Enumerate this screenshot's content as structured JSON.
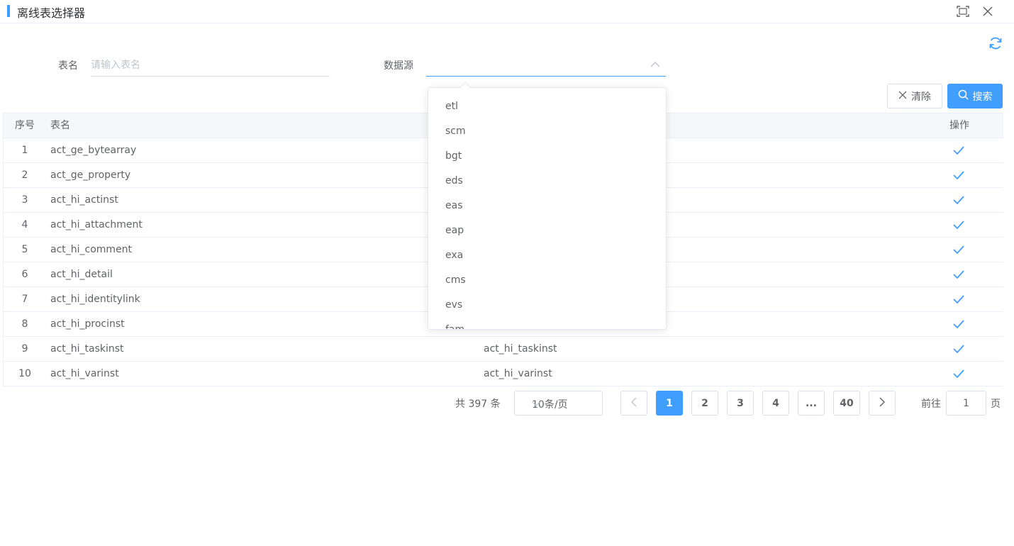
{
  "header": {
    "title": "离线表选择器"
  },
  "filters": {
    "table_name_label": "表名",
    "table_name_placeholder": "请输入表名",
    "table_name_value": "",
    "datasource_label": "数据源",
    "datasource_value": ""
  },
  "buttons": {
    "clear": "清除",
    "search": "搜索"
  },
  "table": {
    "columns": {
      "index": "序号",
      "name": "表名",
      "operation": "操作"
    },
    "rows": [
      {
        "index": "1",
        "name": "act_ge_bytearray",
        "comment": ""
      },
      {
        "index": "2",
        "name": "act_ge_property",
        "comment": ""
      },
      {
        "index": "3",
        "name": "act_hi_actinst",
        "comment": ""
      },
      {
        "index": "4",
        "name": "act_hi_attachment",
        "comment": ""
      },
      {
        "index": "5",
        "name": "act_hi_comment",
        "comment": ""
      },
      {
        "index": "6",
        "name": "act_hi_detail",
        "comment": ""
      },
      {
        "index": "7",
        "name": "act_hi_identitylink",
        "comment": ""
      },
      {
        "index": "8",
        "name": "act_hi_procinst",
        "comment": ""
      },
      {
        "index": "9",
        "name": "act_hi_taskinst",
        "comment": "act_hi_taskinst"
      },
      {
        "index": "10",
        "name": "act_hi_varinst",
        "comment": "act_hi_varinst"
      }
    ]
  },
  "dropdown": {
    "options": [
      "etl",
      "scm",
      "bgt",
      "eds",
      "eas",
      "eap",
      "exa",
      "cms",
      "evs",
      "fam"
    ]
  },
  "pagination": {
    "total": "共 397 条",
    "page_size": "10条/页",
    "pages": [
      "1",
      "2",
      "3",
      "4",
      "...",
      "40"
    ],
    "current_page": "1",
    "goto_label": "前往",
    "goto_value": "1",
    "goto_suffix": "页"
  },
  "colors": {
    "accent": "#409eff",
    "border": "#dcdfe6",
    "text": "#606266"
  },
  "icons": [
    "maximize-icon",
    "close-icon",
    "refresh-icon",
    "chevron-up-icon",
    "close-x-icon",
    "search-icon",
    "check-icon",
    "chevron-down-icon",
    "chevron-left-icon",
    "chevron-right-icon"
  ]
}
